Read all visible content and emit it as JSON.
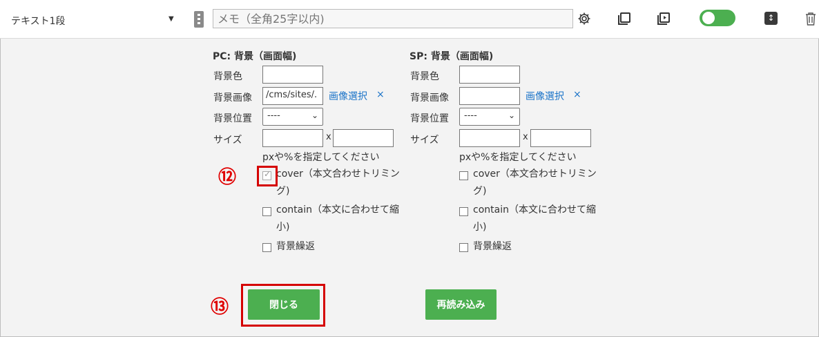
{
  "toolbar": {
    "block_type": "テキスト1段",
    "memo_placeholder": "メモ（全角25字以内)",
    "icons": [
      "gear-icon",
      "copy-icon",
      "preview-icon",
      "toggle-switch",
      "sort-icon",
      "trash-icon"
    ],
    "toggle_on": true,
    "accent": "#4caf50"
  },
  "pc": {
    "title": "PC: 背景（画面幅)",
    "bg_color_label": "背景色",
    "bg_color_value": "",
    "bg_image_label": "背景画像",
    "bg_image_value": "/cms/sites/.",
    "select_image_link": "画像選択",
    "clear_mark": "×",
    "bg_position_label": "背景位置",
    "bg_position_value": "----",
    "size_label": "サイズ",
    "size_x_sep": "x",
    "size_hint": "pxや%を指定してください",
    "cover_line1": "cover（本文合わせトリミン",
    "cover_line2": "グ)",
    "cover_checked": true,
    "contain_line1": "contain（本文に合わせて縮",
    "contain_line2": "小)",
    "contain_checked": false,
    "repeat_label": "背景繰返",
    "repeat_checked": false
  },
  "sp": {
    "title": "SP: 背景（画面幅)",
    "bg_color_label": "背景色",
    "bg_color_value": "",
    "bg_image_label": "背景画像",
    "bg_image_value": "",
    "select_image_link": "画像選択",
    "clear_mark": "×",
    "bg_position_label": "背景位置",
    "bg_position_value": "----",
    "size_label": "サイズ",
    "size_x_sep": "x",
    "size_hint": "pxや%を指定してください",
    "cover_line1": "cover（本文合わせトリミン",
    "cover_line2": "グ)",
    "cover_checked": false,
    "contain_line1": "contain（本文に合わせて縮",
    "contain_line2": "小)",
    "contain_checked": false,
    "repeat_label": "背景繰返",
    "repeat_checked": false
  },
  "annotations": {
    "marker_12": "⑫",
    "marker_13": "⑬",
    "highlight_color": "#d50000"
  },
  "actions": {
    "close_label": "閉じる",
    "reload_label": "再読み込み"
  }
}
